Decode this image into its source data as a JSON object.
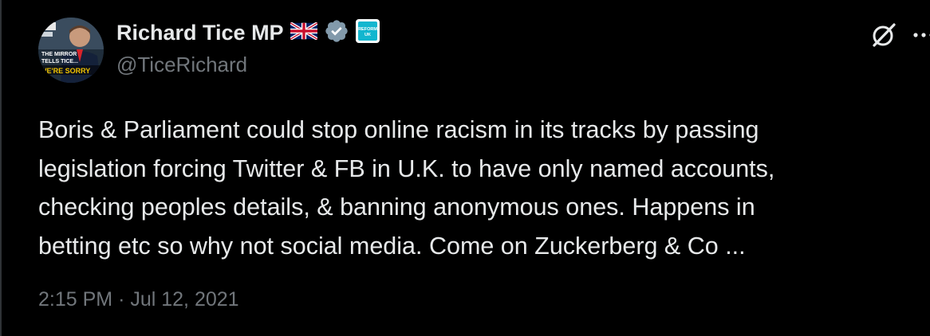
{
  "author": {
    "display_name": "Richard Tice MP",
    "handle": "@TiceRichard",
    "avatar_text": [
      "THE MIRROR",
      "TELLS TICE...",
      "WE'RE SORRY"
    ],
    "badges": [
      "uk-flag-icon",
      "verified-badge-icon",
      "reform-uk-logo-icon"
    ],
    "affiliate_logo_text": "REFORM UK"
  },
  "tweet": {
    "text_lines": [
      "Boris & Parliament could stop online racism in its tracks by passing",
      "legislation forcing Twitter & FB in U.K. to have only named accounts,",
      "checking peoples details, & banning anonymous ones. Happens in",
      "betting etc so why not social media. Come on Zuckerberg & Co ..."
    ],
    "time": "2:15 PM",
    "separator": "·",
    "date": "Jul 12, 2021"
  },
  "toolbar": {
    "icons": [
      "grok-icon",
      "more-options-icon"
    ]
  },
  "colors": {
    "background": "#000000",
    "text_primary": "#e7e9ea",
    "text_secondary": "#71767b",
    "verified_badge": "#829aab",
    "reform_accent": "#12b6cf"
  }
}
